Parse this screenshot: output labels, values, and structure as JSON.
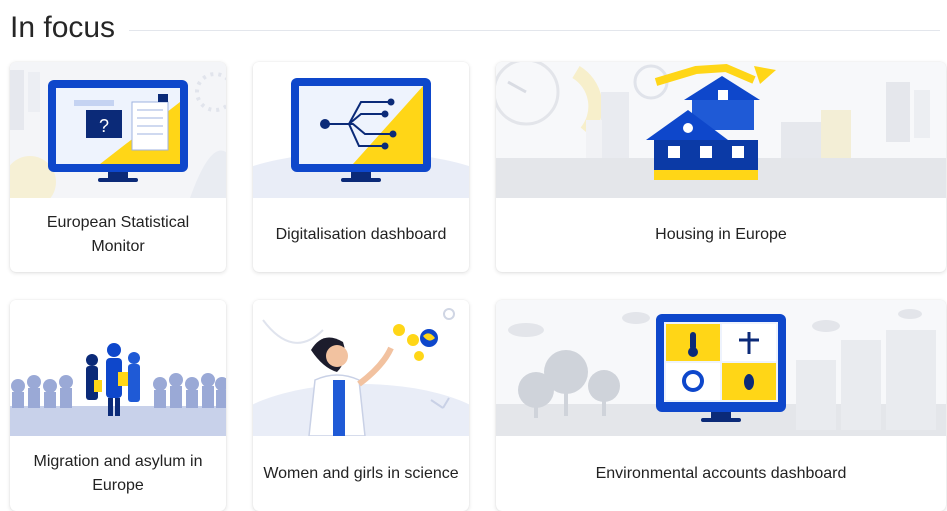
{
  "section": {
    "title": "In focus"
  },
  "cards": [
    {
      "label": "European Statistical Monitor",
      "icon": "statistics-monitor-icon"
    },
    {
      "label": "Digitalisation dashboard",
      "icon": "digital-network-monitor-icon"
    },
    {
      "label": "Housing in Europe",
      "icon": "house-icon"
    },
    {
      "label": "Migration and asylum in Europe",
      "icon": "people-crowd-icon"
    },
    {
      "label": "Women and girls in science",
      "icon": "scientist-woman-icon"
    },
    {
      "label": "Environmental accounts dashboard",
      "icon": "environment-monitor-icon"
    }
  ],
  "colors": {
    "monitor_blue": "#0e47cb",
    "monitor_dark": "#0b2a78",
    "accent_yellow": "#ffd617",
    "screen_light": "#dbe6fb",
    "bg_light": "#eef1f7"
  }
}
